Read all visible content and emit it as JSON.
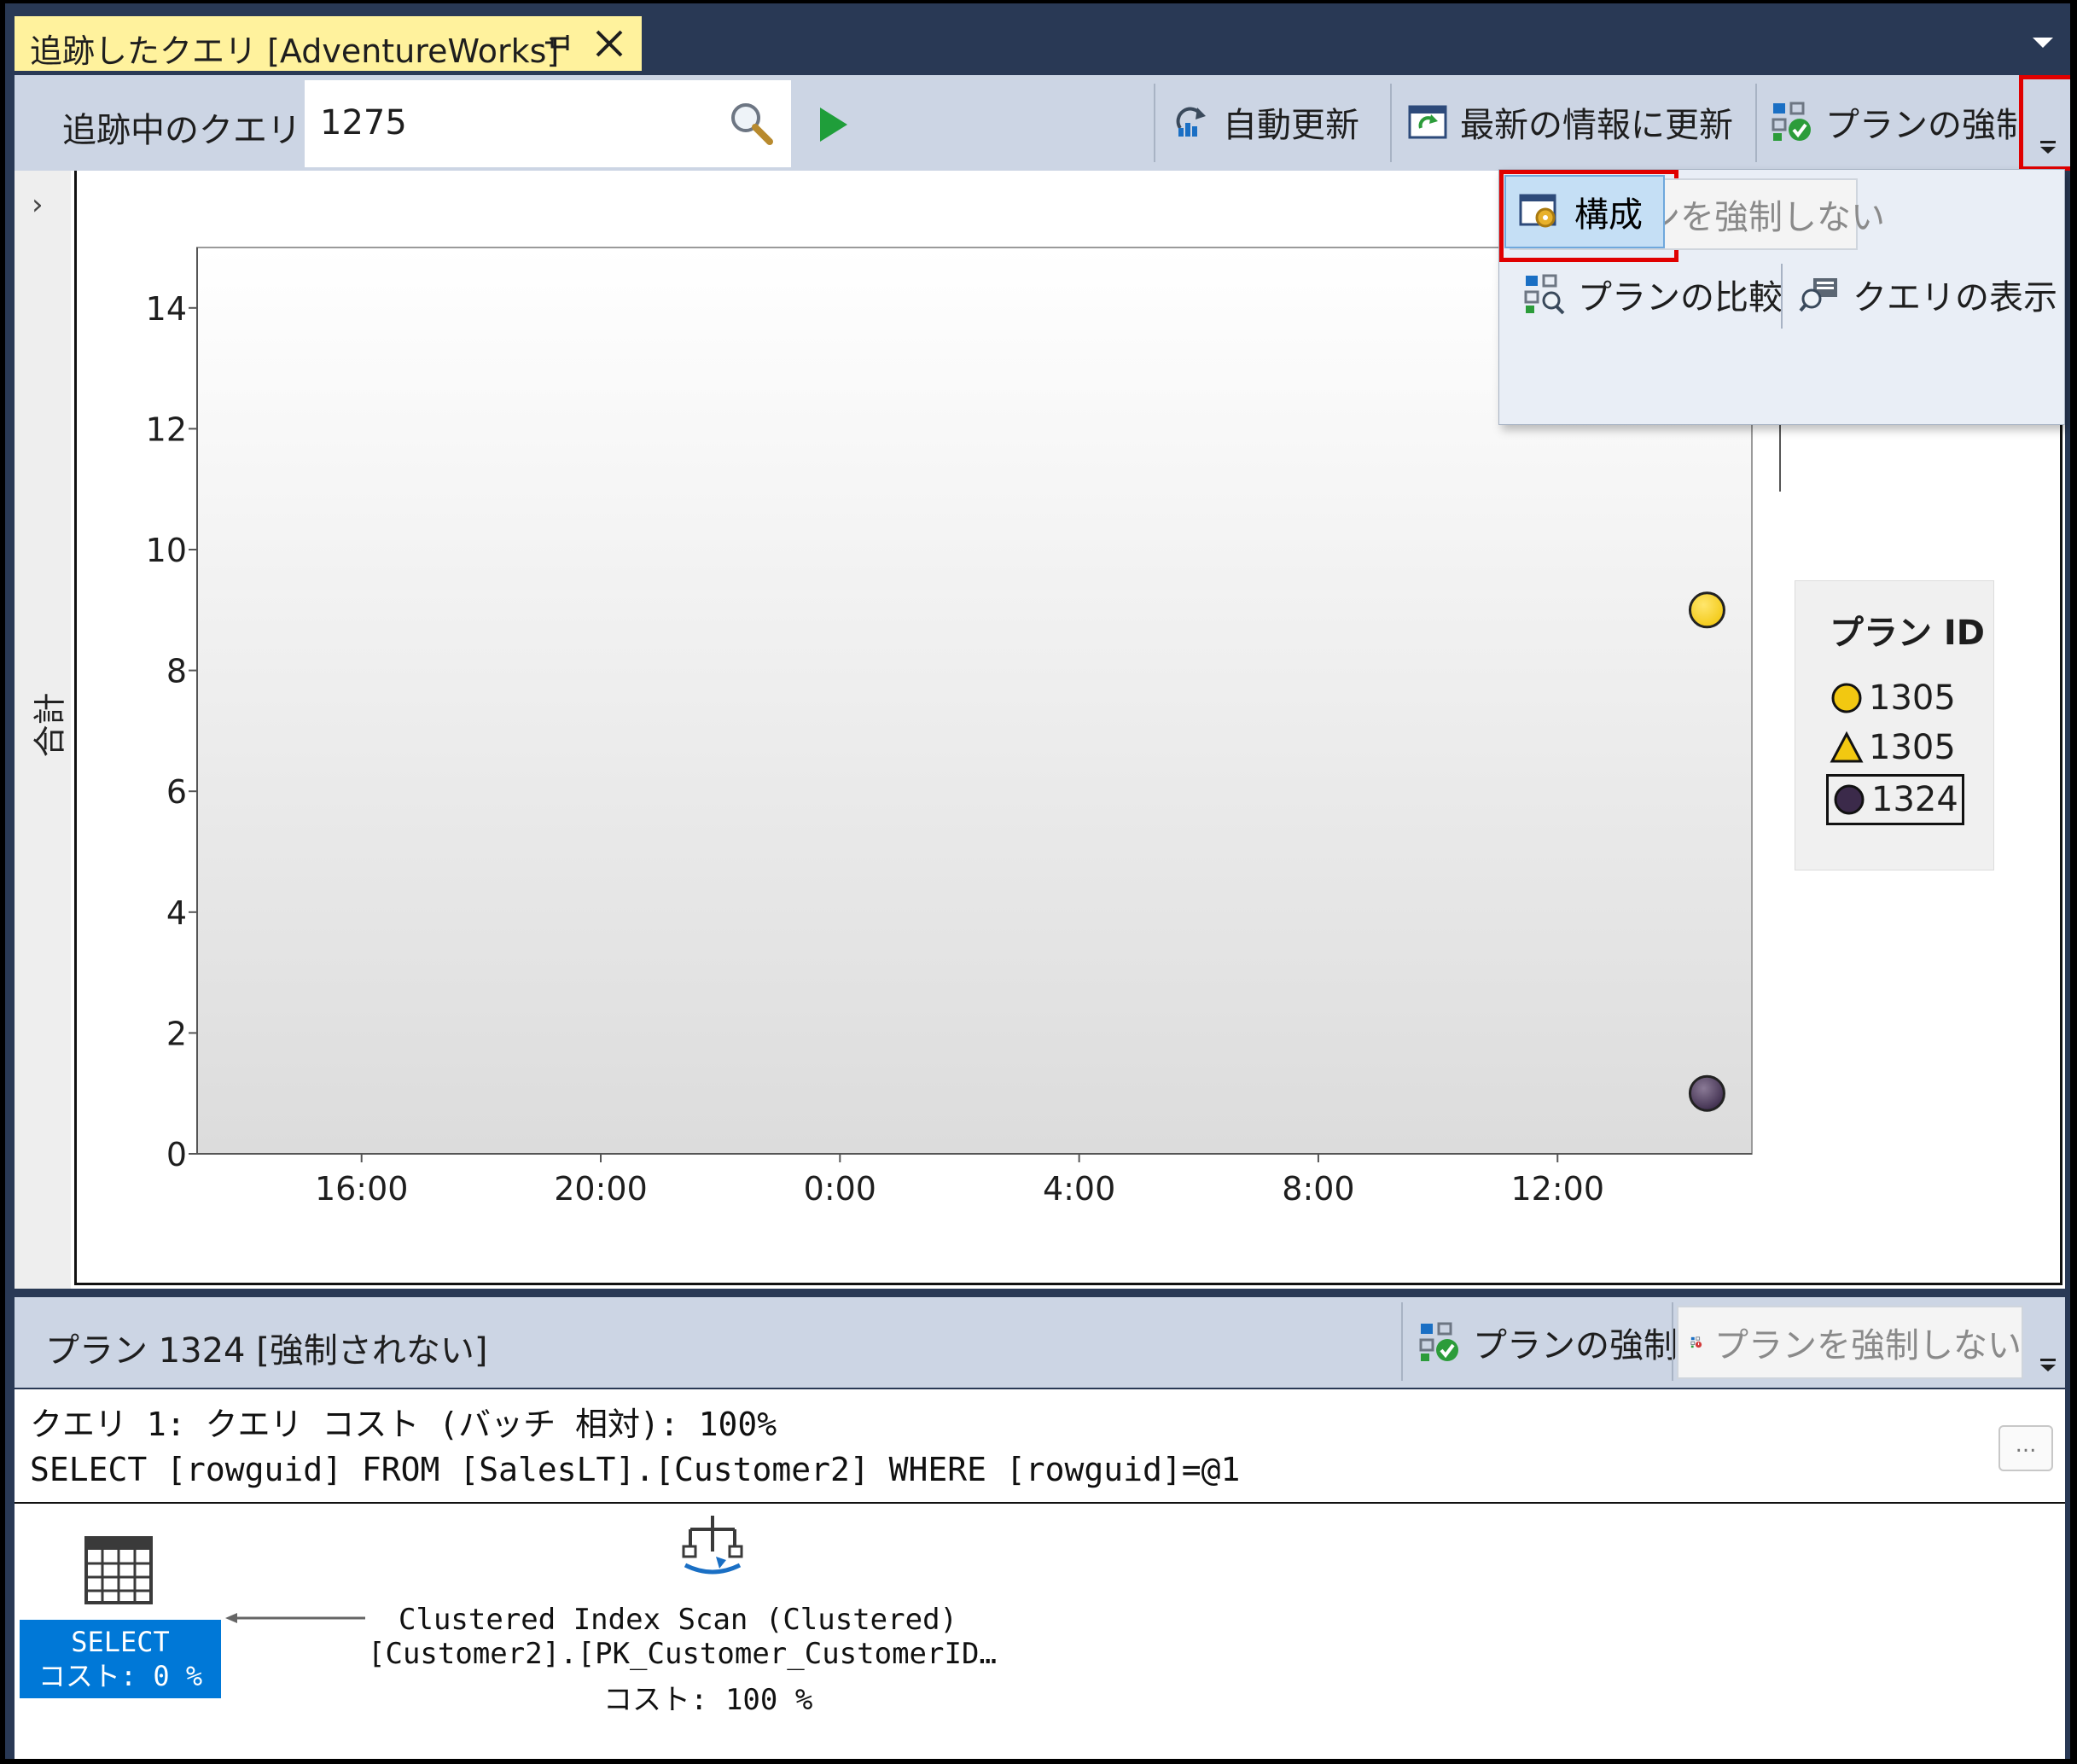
{
  "tab": {
    "title": "追跡したクエリ [AdventureWorks]"
  },
  "toolbar": {
    "tracked_query_label": "追跡中のクエリ",
    "query_id_value": "1275",
    "auto_refresh_label": "自動更新",
    "refresh_label": "最新の情報に更新",
    "force_plan_label": "プランの強制"
  },
  "dropdown": {
    "unforce_plan_label": "プランを強制しない",
    "compare_plans_label": "プランの比較",
    "show_query_label": "クエリの表示",
    "configure_label": "構成"
  },
  "chart_data": {
    "type": "scatter",
    "ylabel": "合計",
    "ylim": [
      0,
      15
    ],
    "yticks": [
      "0",
      "2",
      "4",
      "6",
      "8",
      "10",
      "12",
      "14"
    ],
    "xticks": [
      "16:00",
      "20:00",
      "0:00",
      "4:00",
      "8:00",
      "12:00"
    ],
    "xlim_hours": [
      13.25,
      39.25
    ],
    "series": [
      {
        "name": "1305",
        "marker": "circle",
        "color": "#f2c811",
        "points": [
          {
            "x_hours": 38.5,
            "y": 9
          }
        ]
      },
      {
        "name": "1305",
        "marker": "triangle",
        "color": "#f2c811",
        "points": []
      },
      {
        "name": "1324",
        "marker": "circle",
        "color": "#3b2a4a",
        "points": [
          {
            "x_hours": 38.5,
            "y": 1
          }
        ]
      }
    ],
    "legend": {
      "title": "プラン ID",
      "position": "right",
      "selected": "1324"
    }
  },
  "plan_bar": {
    "label": "プラン 1324 [強制されない]",
    "force_label": "プランの強制",
    "unforce_label": "プランを強制しない"
  },
  "plan_pane": {
    "query_header": "クエリ 1: クエリ コスト (バッチ 相対): 100%",
    "sql_text": "SELECT [rowguid] FROM [SalesLT].[Customer2] WHERE [rowguid]=@1",
    "ellipsis_label": "...",
    "select_node": {
      "name": "SELECT",
      "cost": "コスト: 0 %"
    },
    "scan_node": {
      "line1": "Clustered Index Scan (Clustered)",
      "line2": "[Customer2].[PK_Customer_CustomerID…",
      "cost": "コスト: 100 %"
    }
  },
  "colors": {
    "chrome": "#293955",
    "toolbar": "#ccd5e4",
    "tab_active": "#fff29d",
    "highlight_box": "#e00000",
    "select_node_bg": "#0078d7"
  }
}
